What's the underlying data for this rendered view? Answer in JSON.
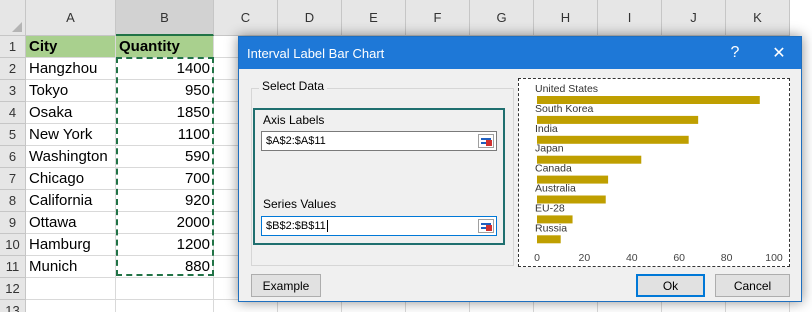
{
  "sheet": {
    "columns": [
      "A",
      "B",
      "C",
      "D",
      "E",
      "F",
      "G",
      "H",
      "I",
      "J",
      "K"
    ],
    "rows": [
      "1",
      "2",
      "3",
      "4",
      "5",
      "6",
      "7",
      "8",
      "9",
      "10",
      "11",
      "12",
      "13"
    ],
    "header": {
      "city": "City",
      "quantity": "Quantity"
    },
    "data": [
      {
        "city": "Hangzhou",
        "quantity": "1400"
      },
      {
        "city": "Tokyo",
        "quantity": "950"
      },
      {
        "city": "Osaka",
        "quantity": "1850"
      },
      {
        "city": "New York",
        "quantity": "1100"
      },
      {
        "city": "Washington",
        "quantity": "590"
      },
      {
        "city": "Chicago",
        "quantity": "700"
      },
      {
        "city": "California",
        "quantity": "920"
      },
      {
        "city": "Ottawa",
        "quantity": "2000"
      },
      {
        "city": "Hamburg",
        "quantity": "1200"
      },
      {
        "city": "Munich",
        "quantity": "880"
      }
    ],
    "header_fill": "#a9d08e",
    "selection_color": "#217346"
  },
  "dialog": {
    "title": "Interval Label Bar Chart",
    "help": "?",
    "close": "✕",
    "group_label": "Select Data",
    "axis_labels": {
      "label": "Axis Labels",
      "value": "$A$2:$A$11"
    },
    "series_values": {
      "label": "Series Values",
      "value": "$B$2:$B$11"
    },
    "buttons": {
      "example": "Example",
      "ok": "Ok",
      "cancel": "Cancel"
    },
    "accent": "#1e78d7"
  },
  "chart_data": {
    "type": "bar",
    "categories": [
      "United States",
      "South Korea",
      "India",
      "Japan",
      "Canada",
      "Australia",
      "EU-28",
      "Russia"
    ],
    "values": [
      94,
      68,
      64,
      44,
      30,
      29,
      15,
      10
    ],
    "xticks": [
      "0",
      "20",
      "40",
      "60",
      "80",
      "100"
    ],
    "xlim": [
      0,
      100
    ],
    "bar_color": "#bf9f00"
  }
}
